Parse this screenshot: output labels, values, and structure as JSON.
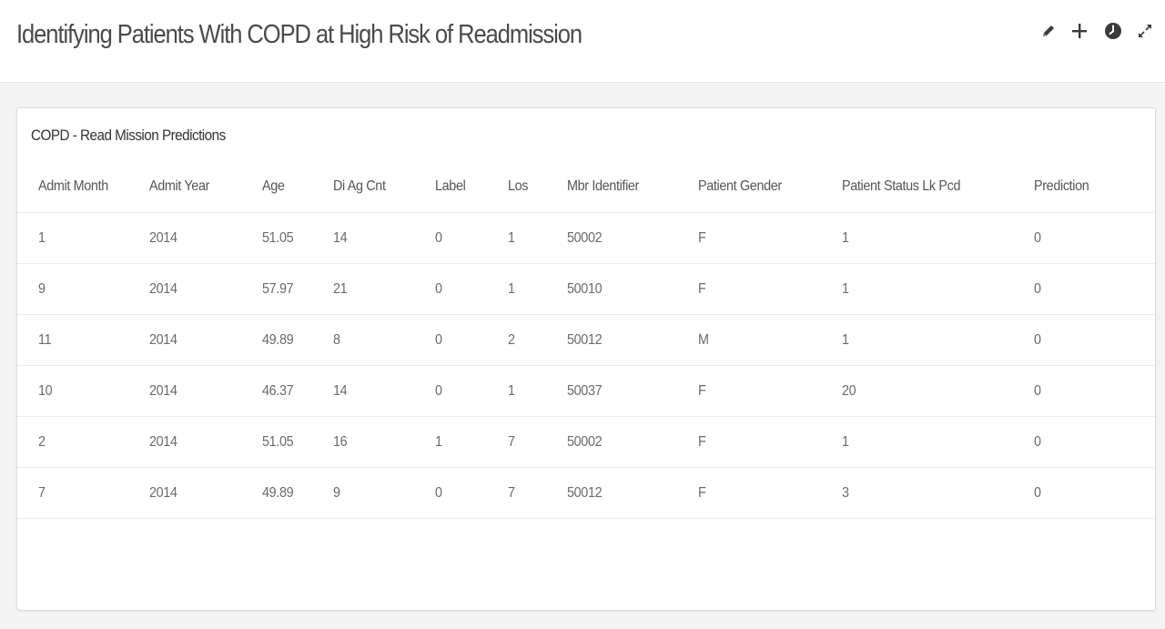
{
  "header": {
    "title": "Identifying Patients With COPD at High Risk of Readmission",
    "tools": [
      {
        "icon": "pencil-icon"
      },
      {
        "icon": "plus-icon"
      },
      {
        "icon": "clock-icon"
      },
      {
        "icon": "expand-icon"
      }
    ]
  },
  "card": {
    "title": "COPD - Read Mission Predictions",
    "columns": [
      "Admit Month",
      "Admit Year",
      "Age",
      "Di Ag Cnt",
      "Label",
      "Los",
      "Mbr Identifier",
      "Patient Gender",
      "Patient Status Lk Pcd",
      "Prediction"
    ],
    "rows": [
      [
        "1",
        "2014",
        "51.05",
        "14",
        "0",
        "1",
        "50002",
        "F",
        "1",
        "0"
      ],
      [
        "9",
        "2014",
        "57.97",
        "21",
        "0",
        "1",
        "50010",
        "F",
        "1",
        "0"
      ],
      [
        "11",
        "2014",
        "49.89",
        "8",
        "0",
        "2",
        "50012",
        "M",
        "1",
        "0"
      ],
      [
        "10",
        "2014",
        "46.37",
        "14",
        "0",
        "1",
        "50037",
        "F",
        "20",
        "0"
      ],
      [
        "2",
        "2014",
        "51.05",
        "16",
        "1",
        "7",
        "50002",
        "F",
        "1",
        "0"
      ],
      [
        "7",
        "2014",
        "49.89",
        "9",
        "0",
        "7",
        "50012",
        "F",
        "3",
        "0"
      ]
    ]
  },
  "colors": {
    "background": "#f4f4f4",
    "card": "#ffffff",
    "text": "#555555",
    "icon": "#3a3a3a"
  }
}
